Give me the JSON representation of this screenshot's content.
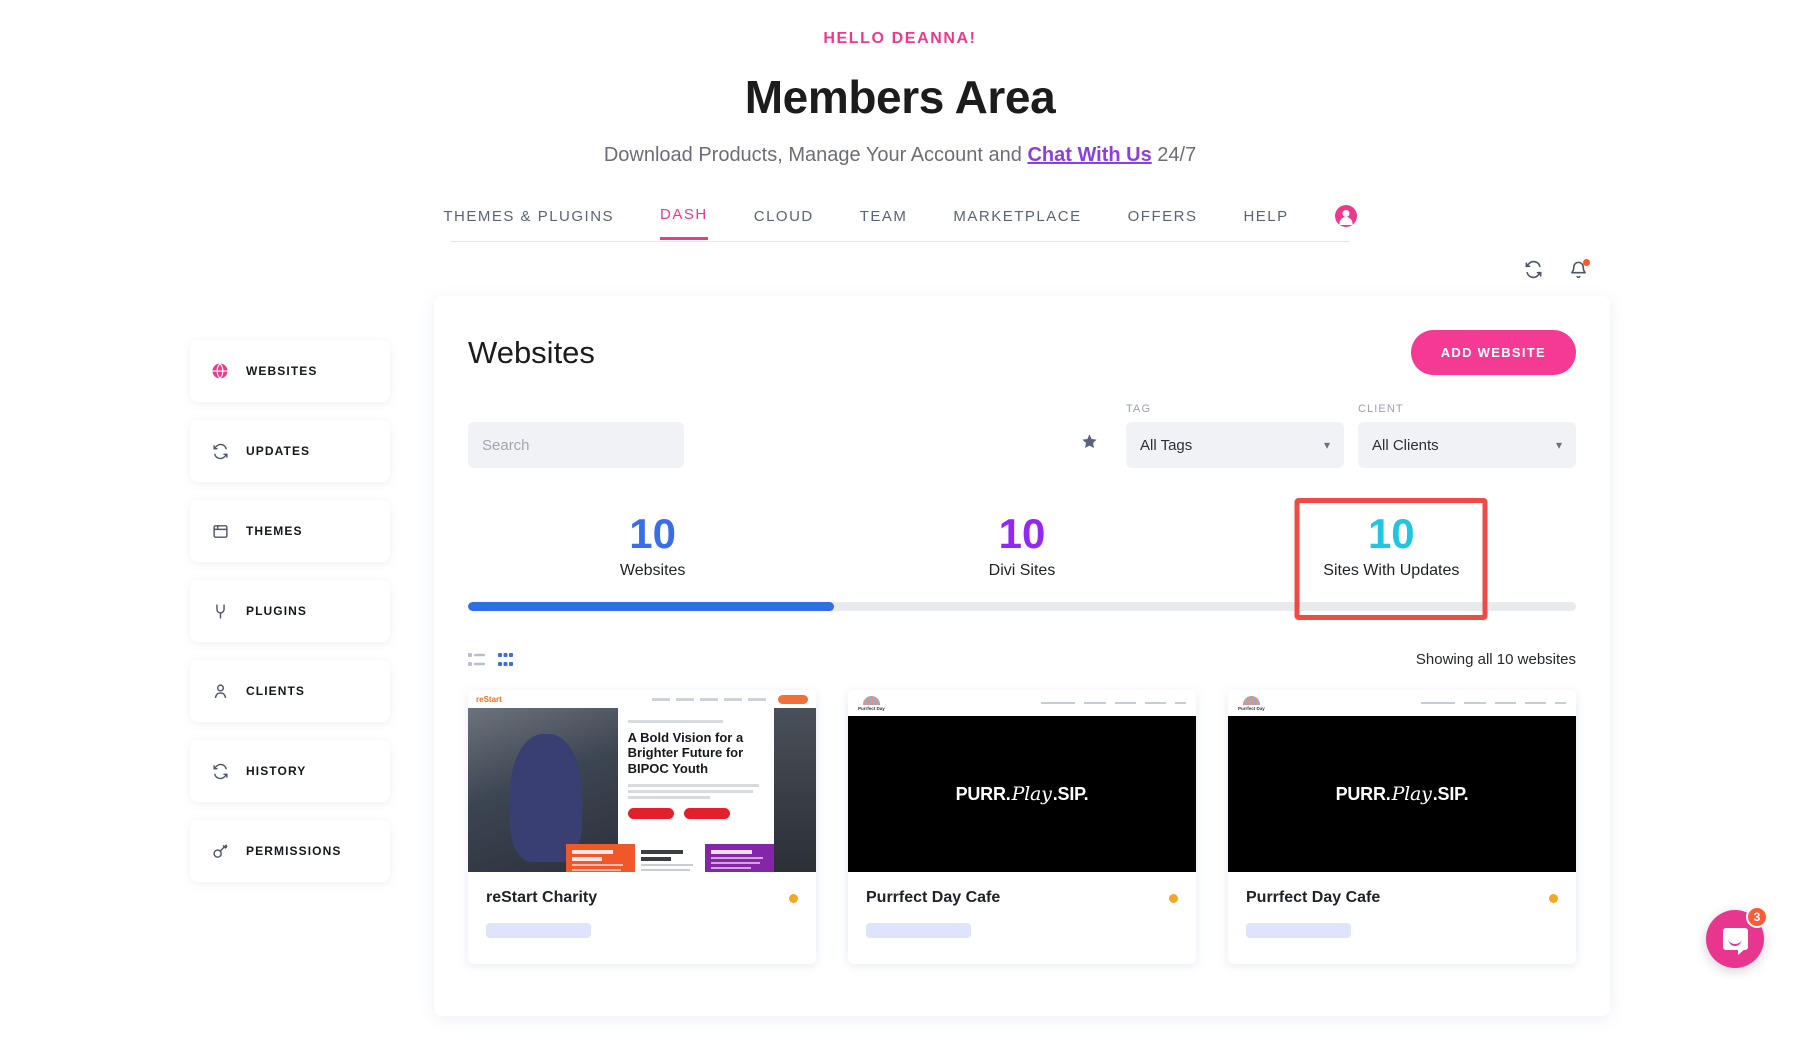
{
  "hero": {
    "greeting": "HELLO DEANNA!",
    "title": "Members Area",
    "subtitle_before": "Download Products, Manage Your Account and ",
    "subtitle_link": "Chat With Us",
    "subtitle_after": " 24/7"
  },
  "nav": {
    "items": [
      {
        "label": "THEMES & PLUGINS",
        "active": false
      },
      {
        "label": "DASH",
        "active": true
      },
      {
        "label": "CLOUD",
        "active": false
      },
      {
        "label": "TEAM",
        "active": false
      },
      {
        "label": "MARKETPLACE",
        "active": false
      },
      {
        "label": "OFFERS",
        "active": false
      },
      {
        "label": "HELP",
        "active": false
      }
    ],
    "avatar_icon": "account-circle-icon"
  },
  "toolbar": {
    "sync_icon": "refresh-icon",
    "notifications_icon": "bell-icon",
    "has_notification": true
  },
  "sidebar": {
    "items": [
      {
        "label": "WEBSITES",
        "icon": "globe-icon",
        "active": true
      },
      {
        "label": "UPDATES",
        "icon": "refresh-icon",
        "active": false
      },
      {
        "label": "THEMES",
        "icon": "window-icon",
        "active": false
      },
      {
        "label": "PLUGINS",
        "icon": "plug-icon",
        "active": false
      },
      {
        "label": "CLIENTS",
        "icon": "user-icon",
        "active": false
      },
      {
        "label": "HISTORY",
        "icon": "refresh-icon",
        "active": false
      },
      {
        "label": "PERMISSIONS",
        "icon": "key-icon",
        "active": false
      }
    ]
  },
  "panel": {
    "title": "Websites",
    "add_button": "ADD WEBSITE",
    "search_placeholder": "Search",
    "search_value": "",
    "favorite_icon": "star-icon",
    "filters": [
      {
        "label": "TAG",
        "value": "All Tags"
      },
      {
        "label": "CLIENT",
        "value": "All Clients"
      }
    ],
    "stats": [
      {
        "value": "10",
        "label": "Websites",
        "color": "#3a6ee8",
        "highlighted": false
      },
      {
        "value": "10",
        "label": "Divi Sites",
        "color": "#9328f0",
        "highlighted": false
      },
      {
        "value": "10",
        "label": "Sites With Updates",
        "color": "#21c5e0",
        "highlighted": true
      }
    ],
    "progress_percent": 33,
    "progress_color": "#2f6fe4",
    "highlight_color": "#ef4b45",
    "view_modes": [
      {
        "icon": "list-view-icon",
        "active": false
      },
      {
        "icon": "grid-view-icon",
        "active": true
      }
    ],
    "showing_text": "Showing all 10 websites",
    "cards": [
      {
        "name": "reStart Charity",
        "status_color": "#f5a623",
        "thumb_type": "restart",
        "thumb": {
          "logo": "reStart",
          "heading": "A Bold Vision for a Brighter Future for BIPOC Youth",
          "tiles": [
            "Supporting Youth in Legal Difficulty",
            "Fostering Strong Relationships",
            "Transforming Lives"
          ]
        }
      },
      {
        "name": "Purrfect Day Cafe",
        "status_color": "#f5a623",
        "thumb_type": "purrfect",
        "thumb": {
          "logo": "Purrfect Day",
          "hero_part1": "PURR.",
          "hero_script": "Play",
          "hero_part2": ".SIP."
        }
      },
      {
        "name": "Purrfect Day Cafe",
        "status_color": "#f5a623",
        "thumb_type": "purrfect",
        "thumb": {
          "logo": "Purrfect Day",
          "hero_part1": "PURR.",
          "hero_script": "Play",
          "hero_part2": ".SIP."
        }
      }
    ]
  },
  "chat": {
    "icon": "chat-bubble-icon",
    "unread_count": "3"
  }
}
